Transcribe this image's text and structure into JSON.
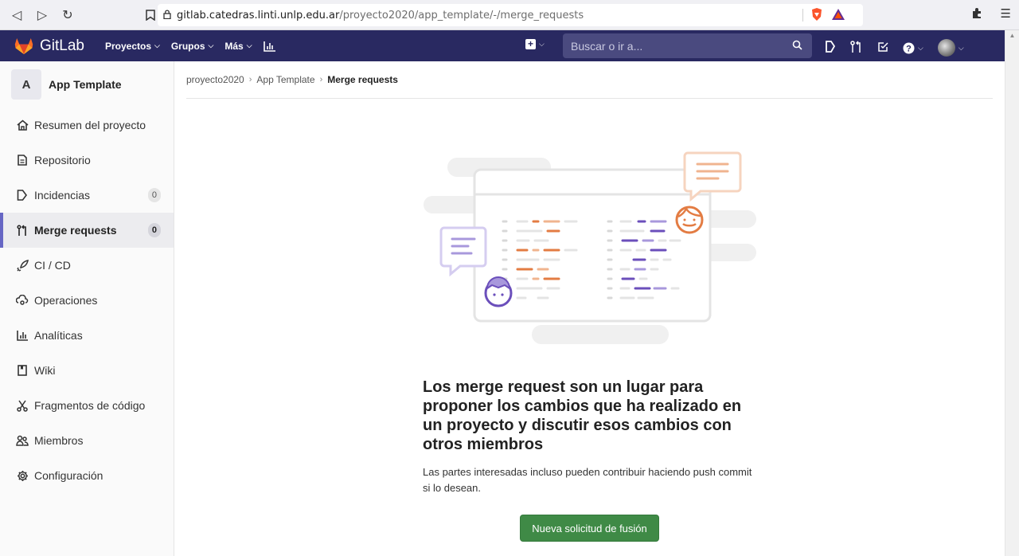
{
  "browser": {
    "url_host": "gitlab.catedras.linti.unlp.edu.ar",
    "url_path": "/proyecto2020/app_template/-/merge_requests"
  },
  "topnav": {
    "brand": "GitLab",
    "links": [
      "Proyectos",
      "Grupos",
      "Más"
    ],
    "search_placeholder": "Buscar o ir a...",
    "colors": {
      "bar": "#292961",
      "search": "#4a4a7f"
    }
  },
  "sidebar": {
    "project_avatar": "A",
    "project_name": "App Template",
    "items": [
      {
        "label": "Resumen del proyecto",
        "icon": "home-icon"
      },
      {
        "label": "Repositorio",
        "icon": "document-icon"
      },
      {
        "label": "Incidencias",
        "icon": "issues-icon",
        "count": "0"
      },
      {
        "label": "Merge requests",
        "icon": "merge-request-icon",
        "count": "0",
        "active": true
      },
      {
        "label": "CI / CD",
        "icon": "rocket-icon"
      },
      {
        "label": "Operaciones",
        "icon": "cloud-icon"
      },
      {
        "label": "Analíticas",
        "icon": "chart-icon"
      },
      {
        "label": "Wiki",
        "icon": "book-icon"
      },
      {
        "label": "Fragmentos de código",
        "icon": "scissors-icon"
      },
      {
        "label": "Miembros",
        "icon": "users-icon"
      },
      {
        "label": "Configuración",
        "icon": "gear-icon"
      }
    ]
  },
  "breadcrumb": [
    "proyecto2020",
    "App Template",
    "Merge requests"
  ],
  "empty_state": {
    "title": "Los merge request son un lugar para proponer los cambios que ha realizado en un proyecto y discutir esos cambios con otros miembros",
    "description": "Las partes interesadas incluso pueden contribuir haciendo push commit si lo desean.",
    "button": "Nueva solicitud de fusión",
    "button_color": "#3f8a46"
  }
}
